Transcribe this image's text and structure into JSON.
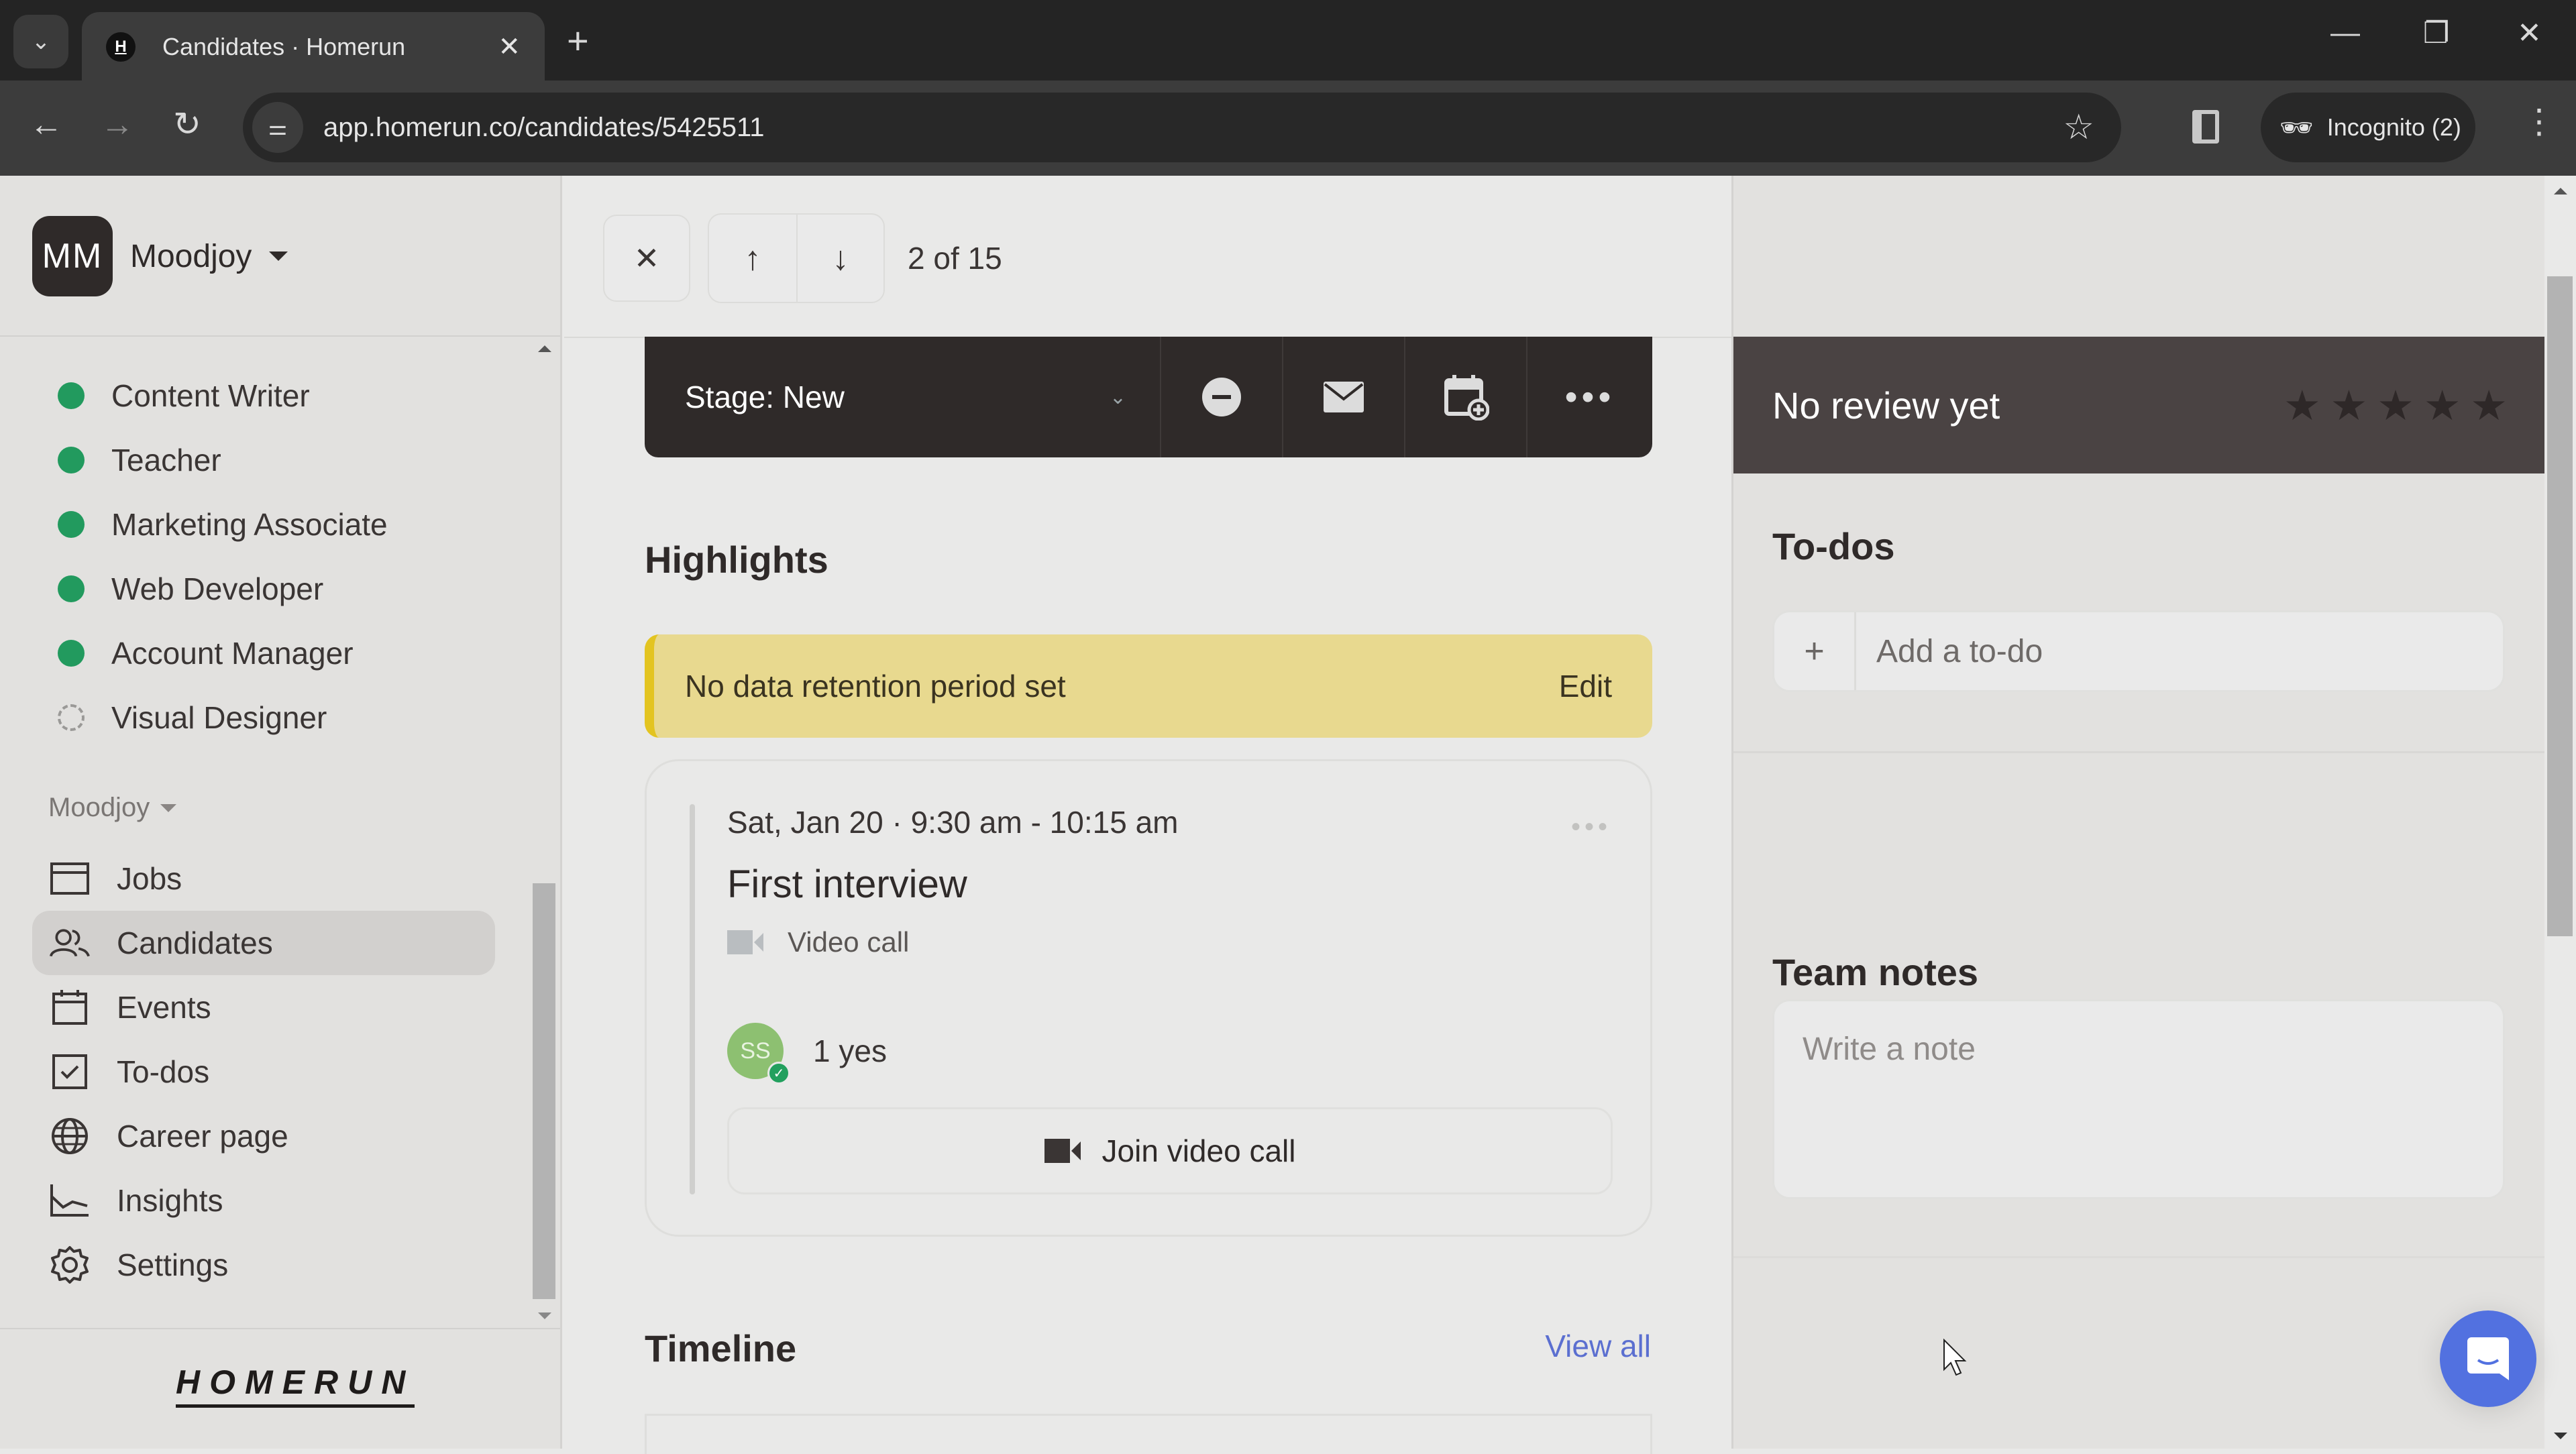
{
  "browser": {
    "tab_title": "Candidates · Homerun",
    "favicon_letter": "H",
    "url": "app.homerun.co/candidates/5425511",
    "incognito_label": "Incognito (2)"
  },
  "sidebar": {
    "org_initials": "MM",
    "org_name": "Moodjoy",
    "jobs": [
      {
        "label": "Content Writer",
        "status": "published"
      },
      {
        "label": "Teacher",
        "status": "published"
      },
      {
        "label": "Marketing Associate",
        "status": "published"
      },
      {
        "label": "Web Developer",
        "status": "published"
      },
      {
        "label": "Account Manager",
        "status": "published"
      },
      {
        "label": "Visual Designer",
        "status": "draft"
      }
    ],
    "section_label": "Moodjoy",
    "nav": [
      {
        "label": "Jobs",
        "icon": "jobs-icon"
      },
      {
        "label": "Candidates",
        "icon": "candidates-icon",
        "active": true
      },
      {
        "label": "Events",
        "icon": "calendar-icon"
      },
      {
        "label": "To-dos",
        "icon": "checkbox-icon"
      },
      {
        "label": "Career page",
        "icon": "globe-icon"
      },
      {
        "label": "Insights",
        "icon": "chart-icon"
      },
      {
        "label": "Settings",
        "icon": "gear-icon"
      }
    ],
    "logo": "HOMERUN"
  },
  "main": {
    "pager": {
      "current": 2,
      "total": 15,
      "label": "2 of 15"
    },
    "stage_label": "Stage: New",
    "highlights_title": "Highlights",
    "retention": {
      "text": "No data retention period set",
      "edit_label": "Edit"
    },
    "event": {
      "when": "Sat, Jan 20 · 9:30 am - 10:15 am",
      "title": "First interview",
      "location": "Video call",
      "attendee_initials": "SS",
      "rsvp": "1 yes",
      "join_label": "Join video call"
    },
    "timeline_title": "Timeline",
    "view_all_label": "View all"
  },
  "right_panel": {
    "review_label": "No review yet",
    "rating": {
      "value": 0,
      "max": 5
    },
    "todos_title": "To-dos",
    "todo_placeholder": "Add a to-do",
    "notes_title": "Team notes",
    "note_placeholder": "Write a note"
  },
  "colors": {
    "accent_blue": "#5271e0",
    "status_green": "#229a5e",
    "warning_yellow": "#e8d98f",
    "dark": "#2f2a29"
  }
}
